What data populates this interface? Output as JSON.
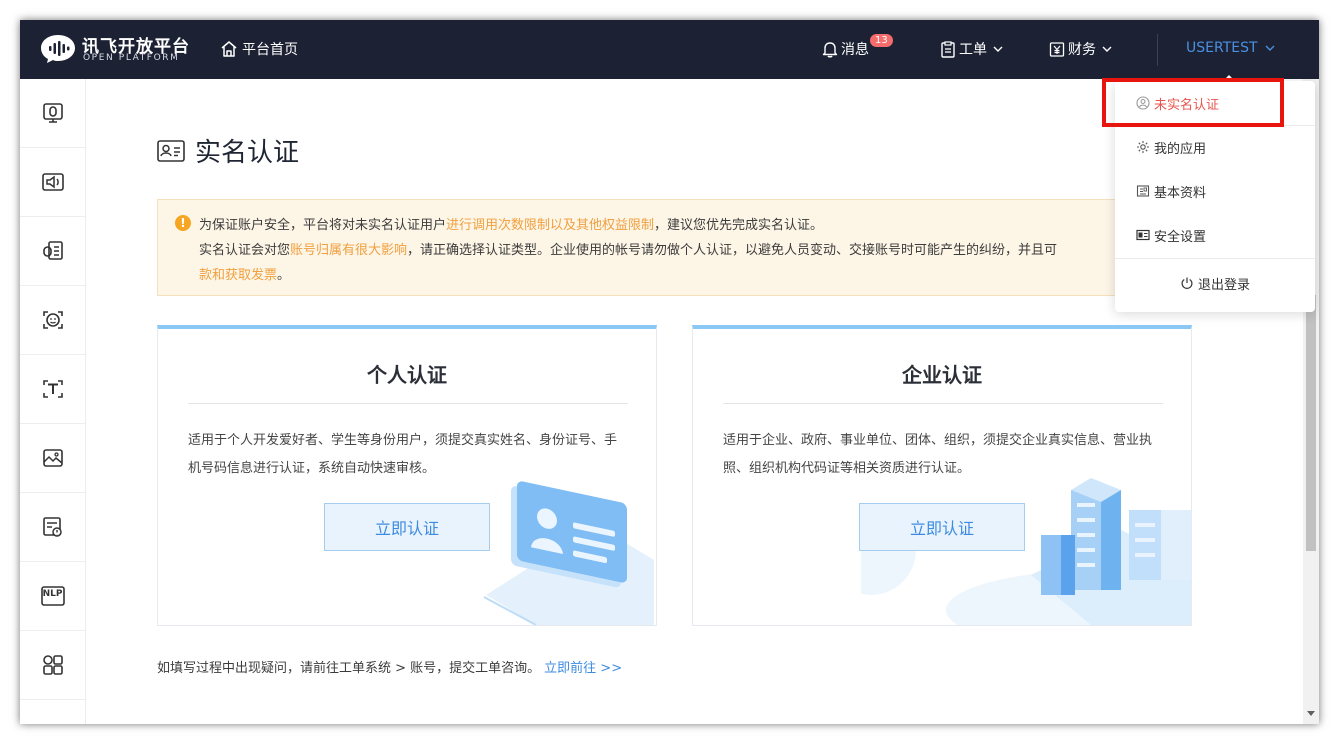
{
  "nav": {
    "logo_title": "讯飞开放平台",
    "logo_sub": "OPEN PLATFORM",
    "home": "平台首页",
    "messages": "消息",
    "messages_badge": "13",
    "tickets": "工单",
    "finance": "财务",
    "user": "USERTEST"
  },
  "sidebar": {
    "items": [
      {
        "icon": "voice-dictation-icon"
      },
      {
        "icon": "speech-synthesis-icon"
      },
      {
        "icon": "voice-document-icon"
      },
      {
        "icon": "face-recognition-icon"
      },
      {
        "icon": "text-recognition-icon"
      },
      {
        "icon": "image-recognition-icon"
      },
      {
        "icon": "content-audit-icon"
      },
      {
        "icon": "nlp-icon",
        "label": "NLP"
      },
      {
        "icon": "apps-grid-icon"
      }
    ]
  },
  "page": {
    "title": "实名认证"
  },
  "notice": {
    "line1_a": "为保证账户安全，平台将对未实名认证用户",
    "line1_hl": "进行调用次数限制以及其他权益限制",
    "line1_b": "，建议您优先完成实名认证。",
    "line2_a": "实名认证会对您",
    "line2_hl": "账号归属有很大影响",
    "line2_b": "，请正确选择认证类型。企业使用的帐号请勿做个人认证，以避免人员变动、交接账号时可能产生的纠纷，并且可",
    "line3_hl": "款和获取发票",
    "line3_b": "。"
  },
  "cards": {
    "personal": {
      "title": "个人认证",
      "desc": "适用于个人开发爱好者、学生等身份用户，须提交真实姓名、身份证号、手机号码信息进行认证，系统自动快速审核。",
      "button": "立即认证"
    },
    "enterprise": {
      "title": "企业认证",
      "desc": "适用于企业、政府、事业单位、团体、组织，须提交企业真实信息、营业执照、组织机构代码证等相关资质进行认证。",
      "button": "立即认证"
    }
  },
  "footer": {
    "note": "如填写过程中出现疑问，请前往工单系统 > 账号，提交工单咨询。",
    "link": "立即前往 >>"
  },
  "dropdown": {
    "items": [
      {
        "label": "未实名认证",
        "icon": "user-circle-icon",
        "active": true
      },
      {
        "label": "我的应用",
        "icon": "gear-icon"
      },
      {
        "label": "基本资料",
        "icon": "profile-card-icon"
      },
      {
        "label": "安全设置",
        "icon": "security-card-icon"
      }
    ],
    "logout": "退出登录"
  },
  "colors": {
    "nav_bg": "#1c2233",
    "accent_blue": "#3d8be0",
    "warning_orange": "#f0a040",
    "highlight_red": "#e8150e"
  }
}
